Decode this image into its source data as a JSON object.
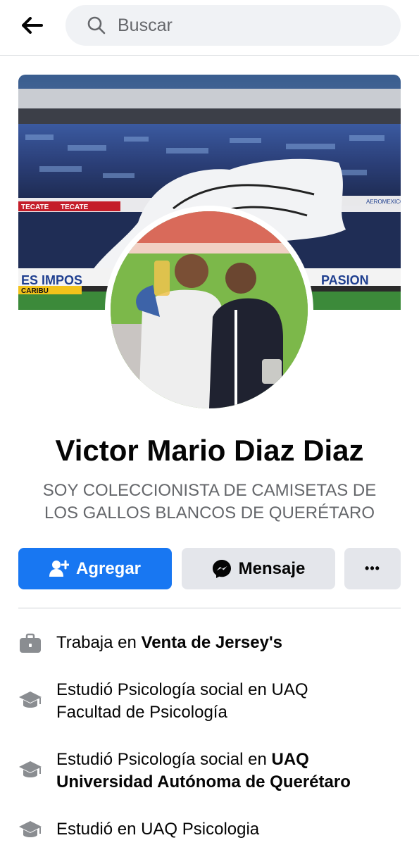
{
  "search": {
    "placeholder": "Buscar"
  },
  "profile": {
    "name": "Victor Mario Diaz Diaz",
    "bio_line1": "SOY COLECCIONISTA DE CAMISETAS DE",
    "bio_line2": "LOS GALLOS BLANCOS DE QUERÉTARO"
  },
  "actions": {
    "add_label": "Agregar",
    "message_label": "Mensaje",
    "more_label": "•••"
  },
  "cover": {
    "banner_left": "ES IMPOS",
    "banner_right": "PASION",
    "sponsor1": "TECATE",
    "sponsor2": "CARIBU",
    "sponsor3": "AEROMEXICO"
  },
  "info": {
    "work_prefix": "Trabaja en ",
    "work_place": "Venta de Jersey's",
    "edu1_line1": "Estudió Psicología social en UAQ",
    "edu1_line2": "Facultad de Psicología",
    "edu2_prefix": "Estudió Psicología social en ",
    "edu2_school_a": "UAQ",
    "edu2_school_b": "Universidad Autónoma de Querétaro",
    "edu3": "Estudió en UAQ Psicologia"
  },
  "icons": {
    "back": "arrow-left-icon",
    "search": "search-icon",
    "add_friend": "person-add-icon",
    "messenger": "messenger-icon",
    "more": "more-dots-icon",
    "work": "briefcase-icon",
    "education": "graduation-cap-icon"
  },
  "colors": {
    "accent": "#1877f2",
    "secondary_button": "#e4e6eb",
    "muted_text": "#65676b",
    "search_bg": "#f0f2f5"
  }
}
